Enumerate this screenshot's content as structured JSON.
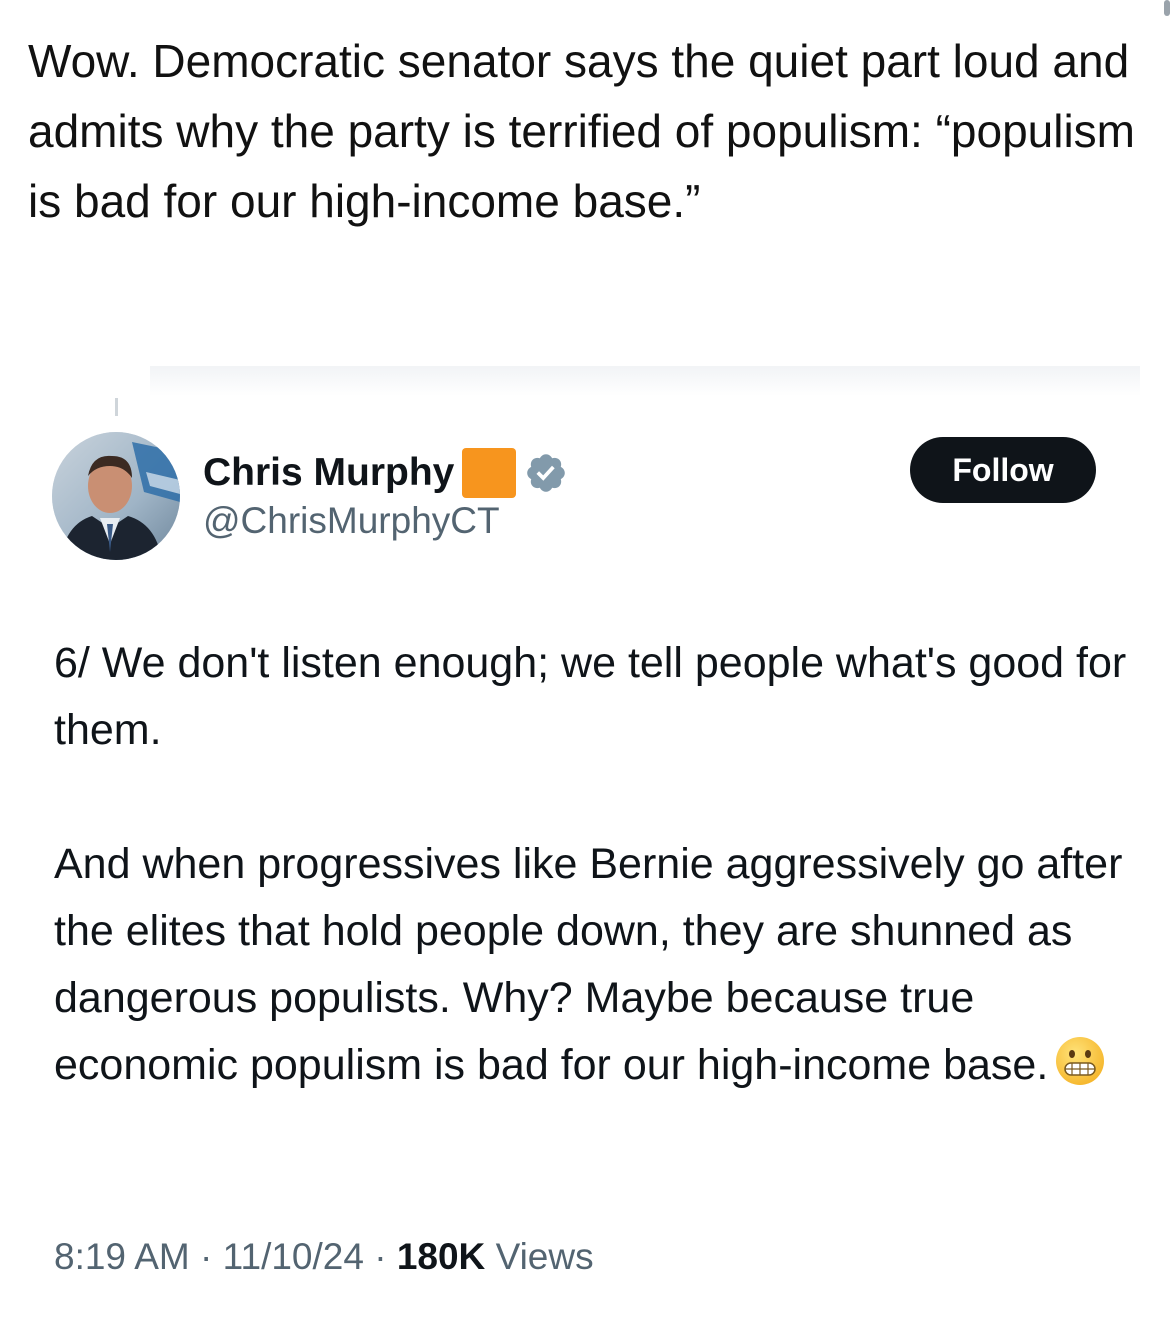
{
  "caption": "Wow. Democratic senator says the quiet part loud and admits why the party is terrified of populism: “populism is bad for our high-income base.”",
  "tweet": {
    "author_name": "Chris Murphy",
    "author_handle": "@ChrisMurphyCT",
    "follow_label": "Follow",
    "paragraph_1": "6/ We don't listen enough; we tell people what's good for them.",
    "paragraph_2": "And when progressives like Bernie aggressively go after the elites that hold people down, they are shunned as dangerous populists. Why? Maybe because true economic populism is bad for our high-income base.",
    "emoji_icon": "grimacing-face-emoji",
    "time": "8:19 AM",
    "separator": "·",
    "date": "11/10/24",
    "views_count": "180K",
    "views_label": "Views"
  },
  "colors": {
    "text_primary": "#0f1419",
    "text_secondary": "#536471",
    "follow_button_bg": "#0f1419",
    "name_flag_orange": "#f7951e",
    "verified_badge": "#829aab"
  }
}
